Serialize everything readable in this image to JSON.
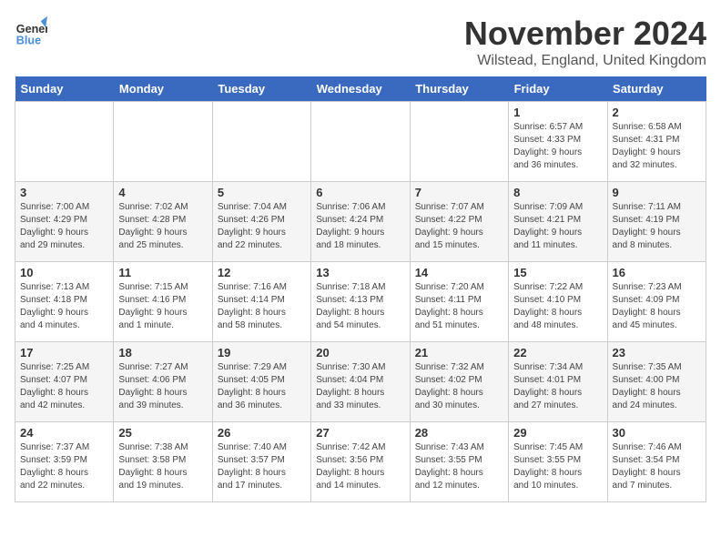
{
  "header": {
    "logo_general": "General",
    "logo_blue": "Blue",
    "month_title": "November 2024",
    "location": "Wilstead, England, United Kingdom"
  },
  "days_of_week": [
    "Sunday",
    "Monday",
    "Tuesday",
    "Wednesday",
    "Thursday",
    "Friday",
    "Saturday"
  ],
  "weeks": [
    [
      {
        "day": "",
        "info": ""
      },
      {
        "day": "",
        "info": ""
      },
      {
        "day": "",
        "info": ""
      },
      {
        "day": "",
        "info": ""
      },
      {
        "day": "",
        "info": ""
      },
      {
        "day": "1",
        "info": "Sunrise: 6:57 AM\nSunset: 4:33 PM\nDaylight: 9 hours\nand 36 minutes."
      },
      {
        "day": "2",
        "info": "Sunrise: 6:58 AM\nSunset: 4:31 PM\nDaylight: 9 hours\nand 32 minutes."
      }
    ],
    [
      {
        "day": "3",
        "info": "Sunrise: 7:00 AM\nSunset: 4:29 PM\nDaylight: 9 hours\nand 29 minutes."
      },
      {
        "day": "4",
        "info": "Sunrise: 7:02 AM\nSunset: 4:28 PM\nDaylight: 9 hours\nand 25 minutes."
      },
      {
        "day": "5",
        "info": "Sunrise: 7:04 AM\nSunset: 4:26 PM\nDaylight: 9 hours\nand 22 minutes."
      },
      {
        "day": "6",
        "info": "Sunrise: 7:06 AM\nSunset: 4:24 PM\nDaylight: 9 hours\nand 18 minutes."
      },
      {
        "day": "7",
        "info": "Sunrise: 7:07 AM\nSunset: 4:22 PM\nDaylight: 9 hours\nand 15 minutes."
      },
      {
        "day": "8",
        "info": "Sunrise: 7:09 AM\nSunset: 4:21 PM\nDaylight: 9 hours\nand 11 minutes."
      },
      {
        "day": "9",
        "info": "Sunrise: 7:11 AM\nSunset: 4:19 PM\nDaylight: 9 hours\nand 8 minutes."
      }
    ],
    [
      {
        "day": "10",
        "info": "Sunrise: 7:13 AM\nSunset: 4:18 PM\nDaylight: 9 hours\nand 4 minutes."
      },
      {
        "day": "11",
        "info": "Sunrise: 7:15 AM\nSunset: 4:16 PM\nDaylight: 9 hours\nand 1 minute."
      },
      {
        "day": "12",
        "info": "Sunrise: 7:16 AM\nSunset: 4:14 PM\nDaylight: 8 hours\nand 58 minutes."
      },
      {
        "day": "13",
        "info": "Sunrise: 7:18 AM\nSunset: 4:13 PM\nDaylight: 8 hours\nand 54 minutes."
      },
      {
        "day": "14",
        "info": "Sunrise: 7:20 AM\nSunset: 4:11 PM\nDaylight: 8 hours\nand 51 minutes."
      },
      {
        "day": "15",
        "info": "Sunrise: 7:22 AM\nSunset: 4:10 PM\nDaylight: 8 hours\nand 48 minutes."
      },
      {
        "day": "16",
        "info": "Sunrise: 7:23 AM\nSunset: 4:09 PM\nDaylight: 8 hours\nand 45 minutes."
      }
    ],
    [
      {
        "day": "17",
        "info": "Sunrise: 7:25 AM\nSunset: 4:07 PM\nDaylight: 8 hours\nand 42 minutes."
      },
      {
        "day": "18",
        "info": "Sunrise: 7:27 AM\nSunset: 4:06 PM\nDaylight: 8 hours\nand 39 minutes."
      },
      {
        "day": "19",
        "info": "Sunrise: 7:29 AM\nSunset: 4:05 PM\nDaylight: 8 hours\nand 36 minutes."
      },
      {
        "day": "20",
        "info": "Sunrise: 7:30 AM\nSunset: 4:04 PM\nDaylight: 8 hours\nand 33 minutes."
      },
      {
        "day": "21",
        "info": "Sunrise: 7:32 AM\nSunset: 4:02 PM\nDaylight: 8 hours\nand 30 minutes."
      },
      {
        "day": "22",
        "info": "Sunrise: 7:34 AM\nSunset: 4:01 PM\nDaylight: 8 hours\nand 27 minutes."
      },
      {
        "day": "23",
        "info": "Sunrise: 7:35 AM\nSunset: 4:00 PM\nDaylight: 8 hours\nand 24 minutes."
      }
    ],
    [
      {
        "day": "24",
        "info": "Sunrise: 7:37 AM\nSunset: 3:59 PM\nDaylight: 8 hours\nand 22 minutes."
      },
      {
        "day": "25",
        "info": "Sunrise: 7:38 AM\nSunset: 3:58 PM\nDaylight: 8 hours\nand 19 minutes."
      },
      {
        "day": "26",
        "info": "Sunrise: 7:40 AM\nSunset: 3:57 PM\nDaylight: 8 hours\nand 17 minutes."
      },
      {
        "day": "27",
        "info": "Sunrise: 7:42 AM\nSunset: 3:56 PM\nDaylight: 8 hours\nand 14 minutes."
      },
      {
        "day": "28",
        "info": "Sunrise: 7:43 AM\nSunset: 3:55 PM\nDaylight: 8 hours\nand 12 minutes."
      },
      {
        "day": "29",
        "info": "Sunrise: 7:45 AM\nSunset: 3:55 PM\nDaylight: 8 hours\nand 10 minutes."
      },
      {
        "day": "30",
        "info": "Sunrise: 7:46 AM\nSunset: 3:54 PM\nDaylight: 8 hours\nand 7 minutes."
      }
    ]
  ]
}
